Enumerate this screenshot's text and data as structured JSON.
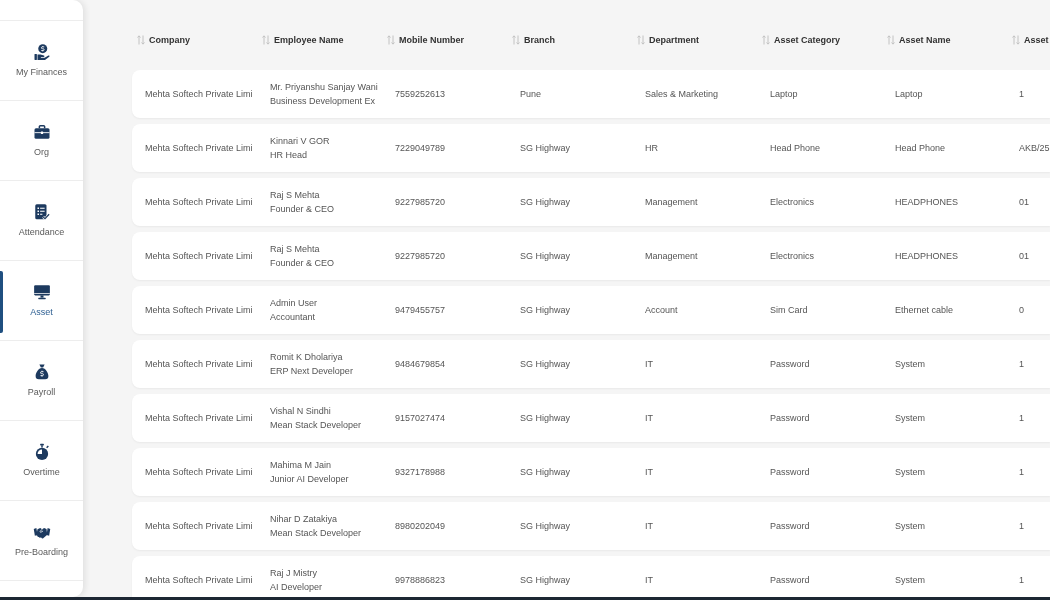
{
  "sidebar": {
    "items": [
      {
        "label": "My Finances",
        "selected": false
      },
      {
        "label": "Org",
        "selected": false
      },
      {
        "label": "Attendance",
        "selected": false
      },
      {
        "label": "Asset",
        "selected": true
      },
      {
        "label": "Payroll",
        "selected": false
      },
      {
        "label": "Overtime",
        "selected": false
      },
      {
        "label": "Pre-Boarding",
        "selected": false
      }
    ]
  },
  "table": {
    "columns": [
      {
        "label": "Company"
      },
      {
        "label": "Employee Name"
      },
      {
        "label": "Mobile Number"
      },
      {
        "label": "Branch"
      },
      {
        "label": "Department"
      },
      {
        "label": "Asset Category"
      },
      {
        "label": "Asset Name"
      },
      {
        "label": "Asset"
      }
    ],
    "rows": [
      {
        "company": "Mehta Softech Private Limi",
        "employee_name": "Mr. Priyanshu Sanjay Wani",
        "job_title": "Business Development Ex",
        "mobile_number": "7559252613",
        "branch": "Pune",
        "department": "Sales & Marketing",
        "asset_category": "Laptop",
        "asset_name": "Laptop",
        "column_8": "1"
      },
      {
        "company": "Mehta Softech Private Limi",
        "employee_name": "Kinnari V GOR",
        "job_title": "HR Head",
        "mobile_number": "7229049789",
        "branch": "SG Highway",
        "department": "HR",
        "asset_category": "Head Phone",
        "asset_name": "Head Phone",
        "column_8": "AKB/25"
      },
      {
        "company": "Mehta Softech Private Limi",
        "employee_name": "Raj S Mehta",
        "job_title": "Founder & CEO",
        "mobile_number": "9227985720",
        "branch": "SG Highway",
        "department": "Management",
        "asset_category": "Electronics",
        "asset_name": "HEADPHONES",
        "column_8": "01"
      },
      {
        "company": "Mehta Softech Private Limi",
        "employee_name": "Raj S Mehta",
        "job_title": "Founder & CEO",
        "mobile_number": "9227985720",
        "branch": "SG Highway",
        "department": "Management",
        "asset_category": "Electronics",
        "asset_name": "HEADPHONES",
        "column_8": "01"
      },
      {
        "company": "Mehta Softech Private Limi",
        "employee_name": "Admin User",
        "job_title": "Accountant",
        "mobile_number": "9479455757",
        "branch": "SG Highway",
        "department": "Account",
        "asset_category": "Sim Card",
        "asset_name": "Ethernet cable",
        "column_8": "0"
      },
      {
        "company": "Mehta Softech Private Limi",
        "employee_name": "Romit K Dholariya",
        "job_title": "ERP Next Developer",
        "mobile_number": "9484679854",
        "branch": "SG Highway",
        "department": "IT",
        "asset_category": "Password",
        "asset_name": "System",
        "column_8": "1"
      },
      {
        "company": "Mehta Softech Private Limi",
        "employee_name": "Vishal N Sindhi",
        "job_title": "Mean Stack Developer",
        "mobile_number": "9157027474",
        "branch": "SG Highway",
        "department": "IT",
        "asset_category": "Password",
        "asset_name": "System",
        "column_8": "1"
      },
      {
        "company": "Mehta Softech Private Limi",
        "employee_name": "Mahima M Jain",
        "job_title": "Junior AI Developer",
        "mobile_number": "9327178988",
        "branch": "SG Highway",
        "department": "IT",
        "asset_category": "Password",
        "asset_name": "System",
        "column_8": "1"
      },
      {
        "company": "Mehta Softech Private Limi",
        "employee_name": "Nihar D Zatakiya",
        "job_title": "Mean Stack Developer",
        "mobile_number": "8980202049",
        "branch": "SG Highway",
        "department": "IT",
        "asset_category": "Password",
        "asset_name": "System",
        "column_8": "1"
      },
      {
        "company": "Mehta Softech Private Limi",
        "employee_name": "Raj J Mistry",
        "job_title": "AI Developer",
        "mobile_number": "9978886823",
        "branch": "SG Highway",
        "department": "IT",
        "asset_category": "Password",
        "asset_name": "System",
        "column_8": "1"
      }
    ]
  }
}
